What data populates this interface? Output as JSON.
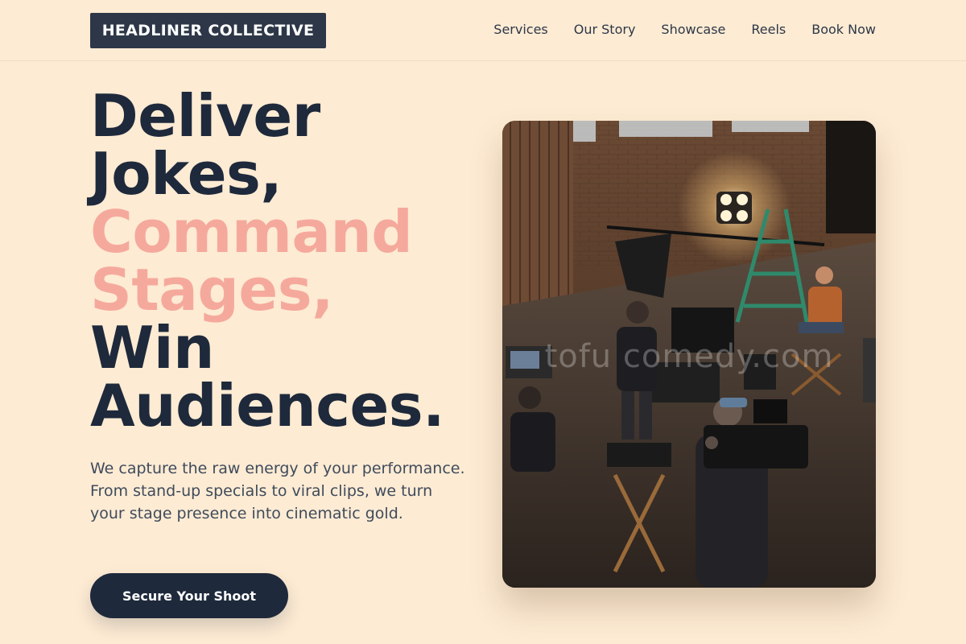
{
  "header": {
    "logo": "HEADLINER COLLECTIVE",
    "nav": [
      "Services",
      "Our Story",
      "Showcase",
      "Reels",
      "Book Now"
    ]
  },
  "hero": {
    "headline": [
      "Deliver",
      "Jokes,",
      "Command",
      "Stages,",
      "Win",
      "Audiences."
    ],
    "description": "We capture the raw energy of your performance. From stand-up specials to viral clips, we turn your stage presence into cinematic gold.",
    "cta": "Secure Your Shoot",
    "image_watermark": "tofu comedy.com"
  },
  "colors": {
    "background": "#fdebd3",
    "primary": "#1e293b",
    "accent": "#f5a99c",
    "logo_bg": "#2d3748"
  }
}
